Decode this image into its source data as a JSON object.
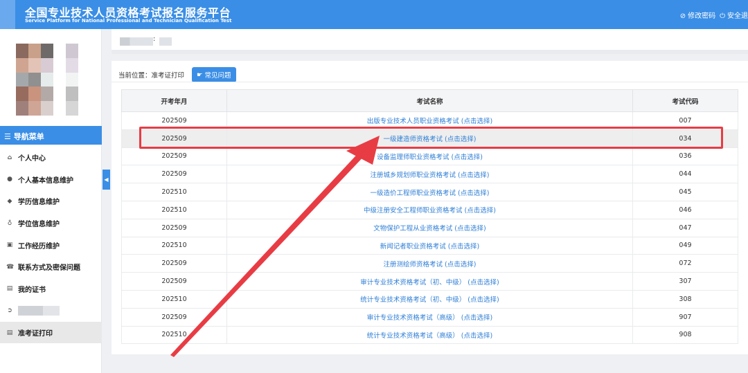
{
  "header": {
    "title": "全国专业技术人员资格考试报名服务平台",
    "subtitle": "Service Platform for National Professional and Technician Qualification Test",
    "change_password": "修改密码",
    "safe_logout": "安全退"
  },
  "user": {
    "colon": ":"
  },
  "sidebar": {
    "nav_head": "导航菜单",
    "items": [
      {
        "label": "个人中心",
        "icon": "home-icon"
      },
      {
        "label": "个人基本信息维护",
        "icon": "user-icon"
      },
      {
        "label": "学历信息维护",
        "icon": "graduation-cap-icon"
      },
      {
        "label": "学位信息维护",
        "icon": "medal-icon"
      },
      {
        "label": "工作经历维护",
        "icon": "briefcase-icon"
      },
      {
        "label": "联系方式及密保问题",
        "icon": "phone-icon"
      },
      {
        "label": "我的证书",
        "icon": "certificate-icon"
      },
      {
        "label": "",
        "icon": "circle-arrow-icon"
      },
      {
        "label": "准考证打印",
        "icon": "list-icon"
      }
    ]
  },
  "breadcrumb": {
    "text": "当前位置：准考证打印",
    "faq_label": "常见问题"
  },
  "table": {
    "headers": [
      "开考年月",
      "考试名称",
      "考试代码"
    ],
    "rows": [
      [
        "202509",
        "出版专业技术人员职业资格考试 (点击选择)",
        "007"
      ],
      [
        "202509",
        "一级建造师资格考试 (点击选择)",
        "034"
      ],
      [
        "202509",
        "设备监理师职业资格考试 (点击选择)",
        "036"
      ],
      [
        "202509",
        "注册城乡规划师职业资格考试 (点击选择)",
        "044"
      ],
      [
        "202510",
        "一级造价工程师职业资格考试 (点击选择)",
        "045"
      ],
      [
        "202510",
        "中级注册安全工程师职业资格考试 (点击选择)",
        "046"
      ],
      [
        "202509",
        "文物保护工程从业资格考试 (点击选择)",
        "047"
      ],
      [
        "202510",
        "新闻记者职业资格考试 (点击选择)",
        "049"
      ],
      [
        "202509",
        "注册测绘师资格考试 (点击选择)",
        "072"
      ],
      [
        "202509",
        "审计专业技术资格考试（初、中级） (点击选择)",
        "307"
      ],
      [
        "202510",
        "统计专业技术资格考试（初、中级） (点击选择)",
        "308"
      ],
      [
        "202509",
        "审计专业技术资格考试（高级） (点击选择)",
        "907"
      ],
      [
        "202510",
        "统计专业技术资格考试（高级） (点击选择)",
        "908"
      ]
    ],
    "highlighted_row": 1
  },
  "colors": {
    "accent": "#3a8ee6",
    "link": "#2f7fd6",
    "annotation_red": "#e83c44"
  }
}
